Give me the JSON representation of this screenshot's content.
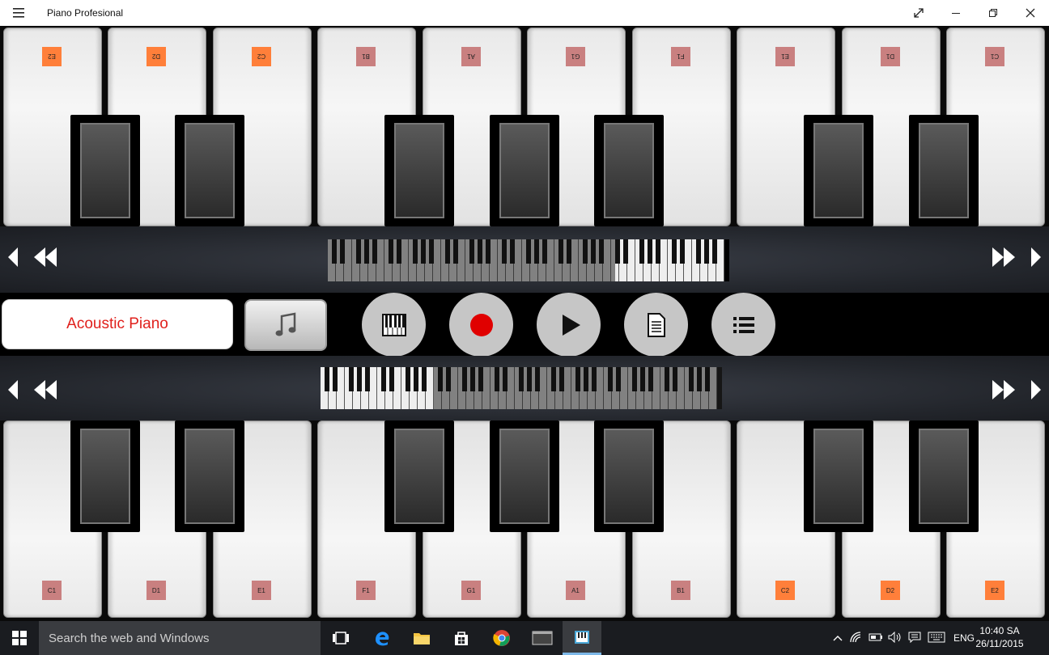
{
  "window": {
    "title": "Piano Profesional",
    "menu_icon": "hamburger-icon",
    "controls": [
      "expand-icon",
      "minimize-icon",
      "restore-icon",
      "close-icon"
    ]
  },
  "top_keyboard": {
    "labels": [
      {
        "text": "E2",
        "color": "#ff7f3a"
      },
      {
        "text": "D2",
        "color": "#ff7f3a"
      },
      {
        "text": "C2",
        "color": "#ff7f3a"
      },
      {
        "text": "B1",
        "color": "#c98080"
      },
      {
        "text": "A1",
        "color": "#c98080"
      },
      {
        "text": "G1",
        "color": "#c98080"
      },
      {
        "text": "F1",
        "color": "#c98080"
      },
      {
        "text": "E1",
        "color": "#c98080"
      },
      {
        "text": "D1",
        "color": "#c98080"
      },
      {
        "text": "C1",
        "color": "#c98080"
      }
    ]
  },
  "bottom_keyboard": {
    "labels": [
      {
        "text": "C1",
        "color": "#c98080"
      },
      {
        "text": "D1",
        "color": "#c98080"
      },
      {
        "text": "E1",
        "color": "#c98080"
      },
      {
        "text": "F1",
        "color": "#c98080"
      },
      {
        "text": "G1",
        "color": "#c98080"
      },
      {
        "text": "A1",
        "color": "#c98080"
      },
      {
        "text": "B1",
        "color": "#c98080"
      },
      {
        "text": "C2",
        "color": "#ff7f3a"
      },
      {
        "text": "D2",
        "color": "#ff7f3a"
      },
      {
        "text": "E2",
        "color": "#ff7f3a"
      }
    ]
  },
  "controls": {
    "instrument": "Acoustic Piano",
    "note_icon": "music-note-icon",
    "buttons": [
      "keyboard-icon",
      "record-icon",
      "play-icon",
      "document-icon",
      "list-icon"
    ],
    "record_color": "#e00000"
  },
  "taskbar": {
    "search_placeholder": "Search the web and Windows",
    "language": "ENG",
    "time": "10:40 SA",
    "date": "26/11/2015"
  }
}
